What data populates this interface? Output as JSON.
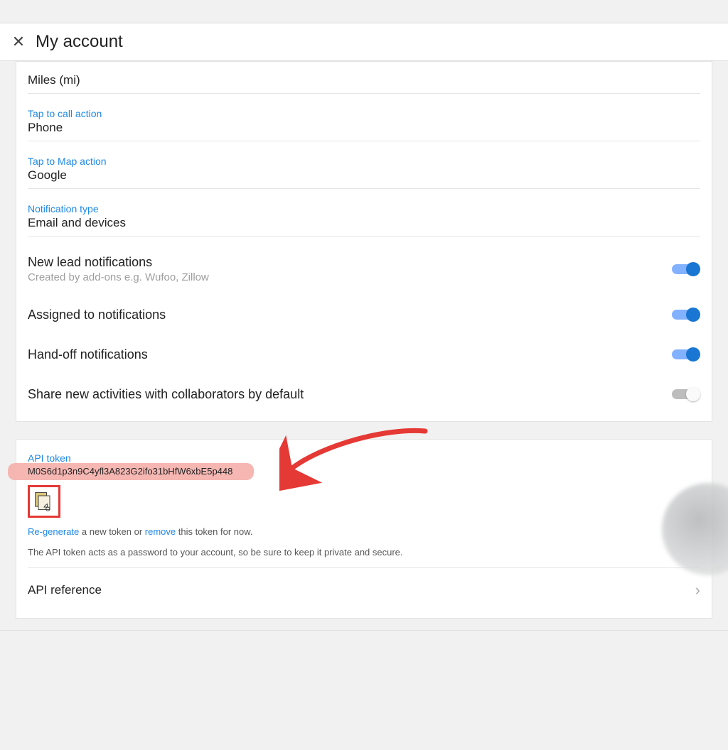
{
  "header": {
    "title": "My account"
  },
  "fields": {
    "distance_value": "Miles (mi)",
    "call_label": "Tap to call action",
    "call_value": "Phone",
    "map_label": "Tap to Map action",
    "map_value": "Google",
    "notif_label": "Notification type",
    "notif_value": "Email and devices"
  },
  "toggles": {
    "newlead_title": "New lead notifications",
    "newlead_sub": "Created by add-ons e.g. Wufoo, Zillow",
    "assigned_title": "Assigned to notifications",
    "handoff_title": "Hand-off notifications",
    "share_title": "Share new activities with collaborators by default"
  },
  "api": {
    "label": "API token",
    "token": "M0S6d1p3n9C4yfl3A823G2ifo31bHfW6xbE5p448",
    "regen": "Re-generate",
    "regen_after": " a new token or ",
    "remove": "remove",
    "remove_after": " this token for now.",
    "note": "The API token acts as a password to your account, so be sure to keep it private and secure.",
    "reference": "API reference"
  }
}
